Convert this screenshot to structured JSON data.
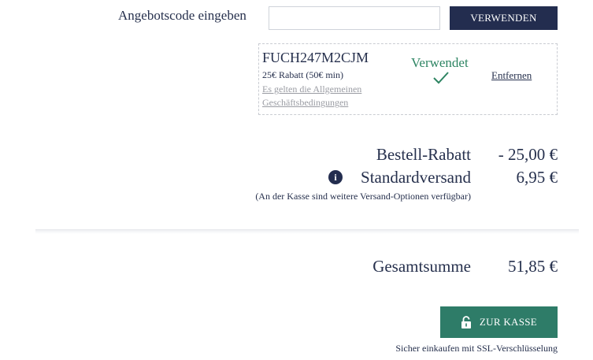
{
  "coupon": {
    "label": "Angebotscode eingeben",
    "input_value": "",
    "apply_label": "VERWENDEN"
  },
  "applied_coupon": {
    "code": "FUCH247M2CJM",
    "description": "25€ Rabatt (50€ min)",
    "terms_line1": "Es gelten die Allgemeinen",
    "terms_line2": "Geschäftsbedingungen",
    "status": "Verwendet",
    "remove_label": "Entfernen"
  },
  "summary": {
    "discount_label": "Bestell-Rabatt",
    "discount_value": "- 25,00 €",
    "shipping_label": "Standardversand",
    "shipping_value": "6,95 €",
    "shipping_note": "(An der Kasse sind weitere Versand-Optionen verfügbar)",
    "info_glyph": "i",
    "total_label": "Gesamtsumme",
    "total_value": "51,85 €"
  },
  "checkout": {
    "button_label": "ZUR KASSE",
    "ssl_note": "Sicher einkaufen mit SSL-Verschlüsselung"
  },
  "colors": {
    "navy": "#232d4f",
    "green": "#2e7c68",
    "used_green": "#2e8563"
  },
  "icons": {
    "check": "check-icon",
    "info": "info-icon",
    "lock": "lock-icon"
  }
}
